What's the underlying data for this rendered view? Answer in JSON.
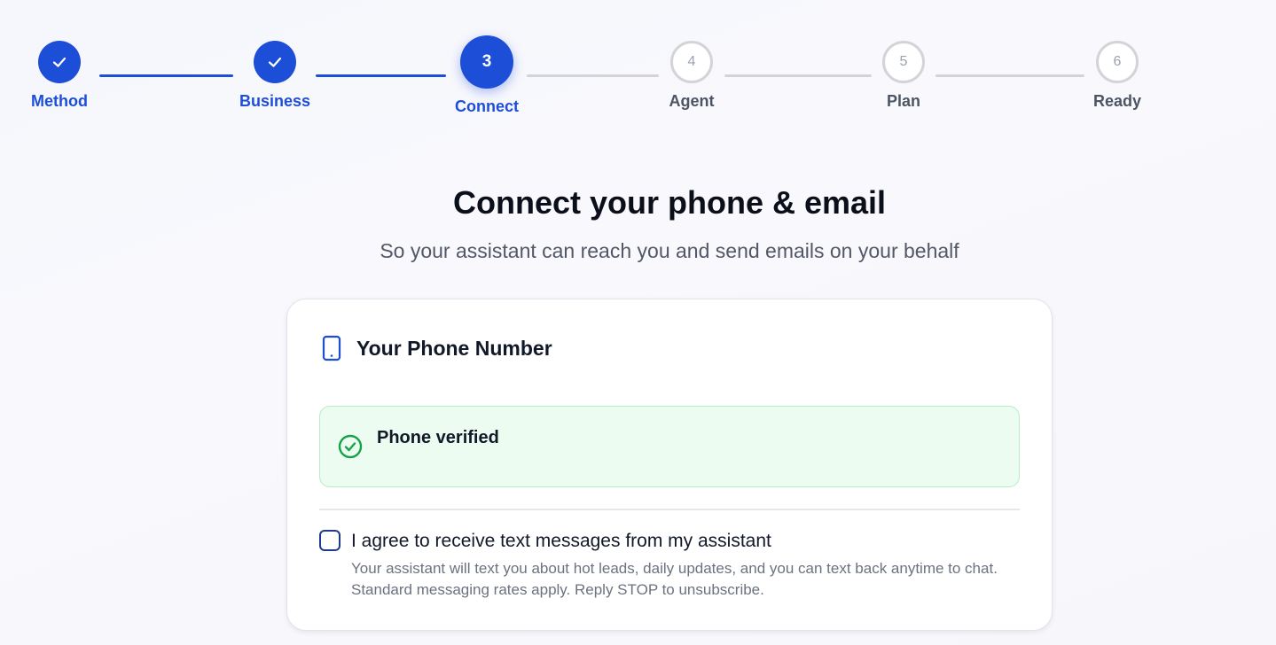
{
  "stepper": {
    "steps": [
      {
        "label": "Method",
        "number": "1",
        "state": "done"
      },
      {
        "label": "Business",
        "number": "2",
        "state": "done"
      },
      {
        "label": "Connect",
        "number": "3",
        "state": "active"
      },
      {
        "label": "Agent",
        "number": "4",
        "state": "todo"
      },
      {
        "label": "Plan",
        "number": "5",
        "state": "todo"
      },
      {
        "label": "Ready",
        "number": "6",
        "state": "todo"
      }
    ]
  },
  "page": {
    "title": "Connect your phone & email",
    "subtitle": "So your assistant can reach you and send emails on your behalf"
  },
  "phone_card": {
    "icon": "smartphone-icon",
    "title": "Your Phone Number",
    "status_icon": "check-circle-icon",
    "status_text": "Phone verified",
    "consent": {
      "checked": false,
      "label": "I agree to receive text messages from my assistant",
      "description": "Your assistant will text you about hot leads, daily updates, and you can text back anytime to chat. Standard messaging rates apply. Reply STOP to unsubscribe."
    }
  },
  "colors": {
    "primary": "#1d4ed8",
    "inactive": "#d4d4d8",
    "success": "#16a34a",
    "success_bg": "#edfcf1"
  }
}
